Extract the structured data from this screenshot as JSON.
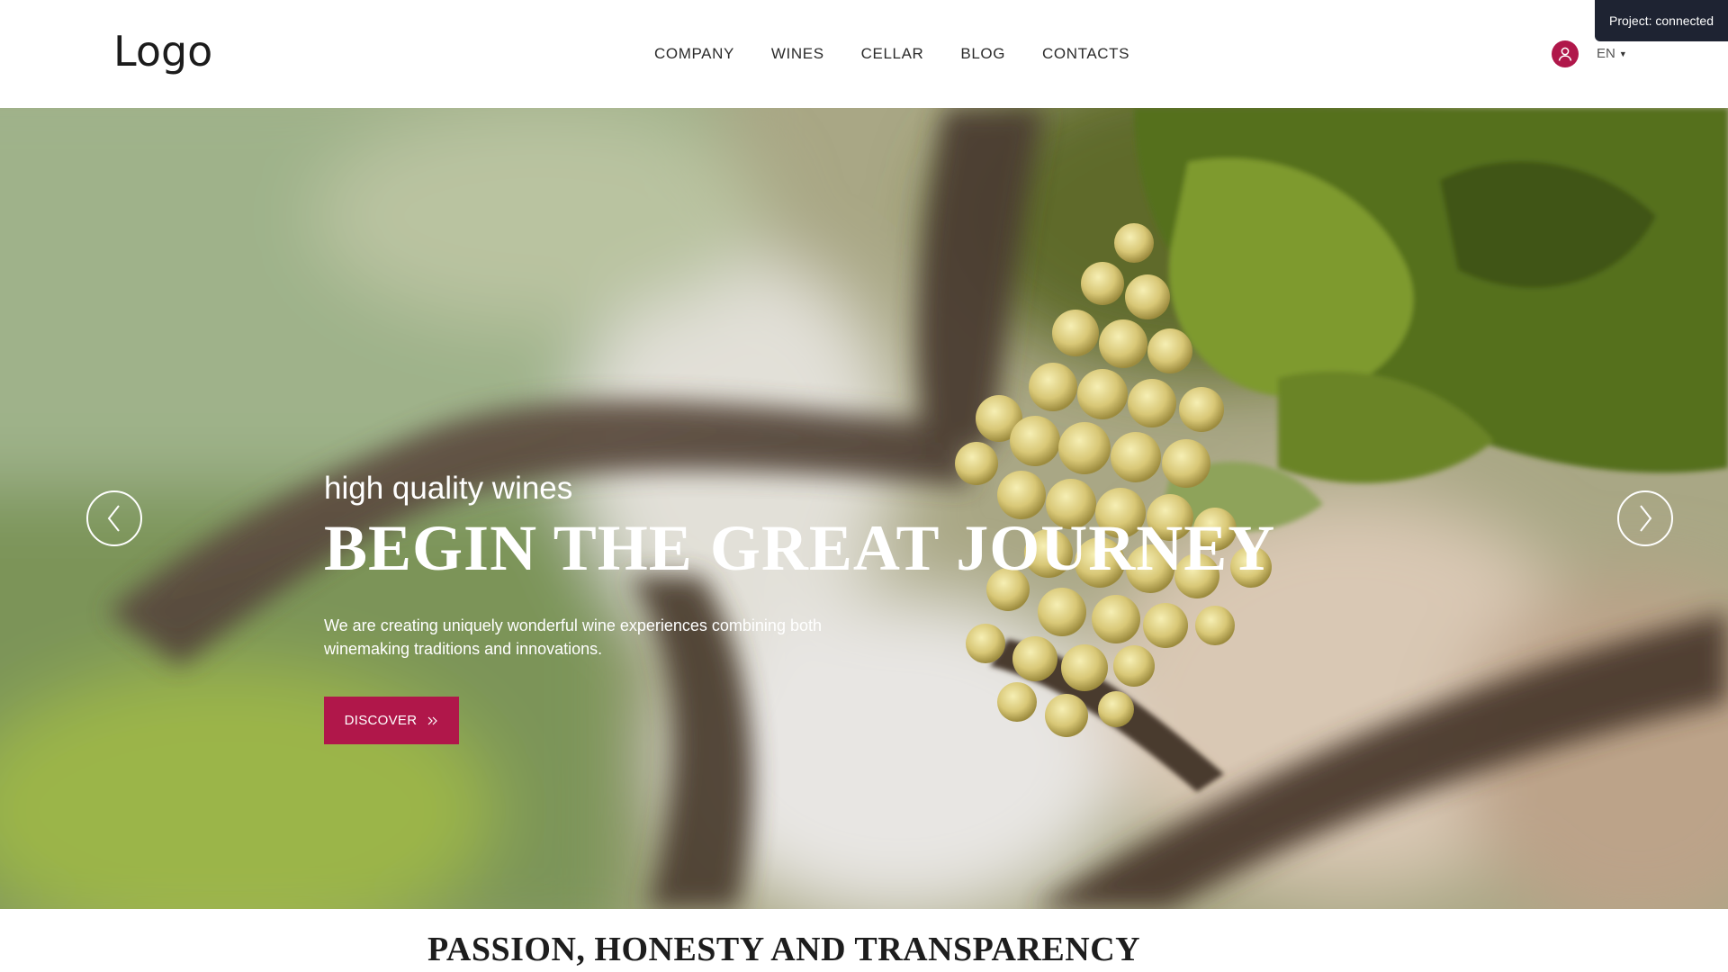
{
  "header": {
    "logo": "Logo",
    "nav": [
      "COMPANY",
      "WINES",
      "CELLAR",
      "BLOG",
      "CONTACTS"
    ],
    "language": "EN",
    "user_icon": "user-icon",
    "status": "Project: connected"
  },
  "hero": {
    "subtitle": "high quality wines",
    "headline": "BEGIN THE GREAT JOURNEY",
    "description": "We are creating uniquely wonderful wine experiences combining both winemaking traditions and innovations.",
    "cta_label": "DISCOVER",
    "cta_icon": "double-chevron-right-icon",
    "prev_icon": "chevron-left-icon",
    "next_icon": "chevron-right-icon",
    "colors": {
      "accent": "#b0174a"
    }
  },
  "section": {
    "title": "PASSION, HONESTY AND TRANSPARENCY"
  }
}
